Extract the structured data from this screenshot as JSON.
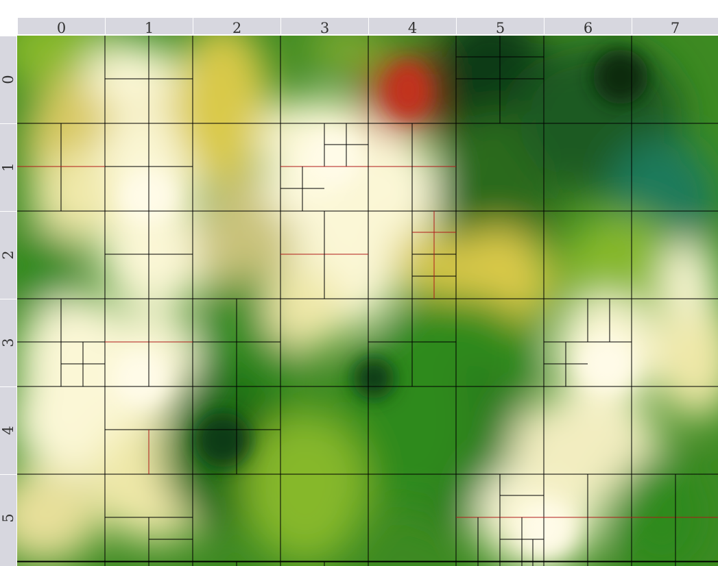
{
  "grid": {
    "columns": [
      "0",
      "1",
      "2",
      "3",
      "4",
      "5",
      "6",
      "7"
    ],
    "rows": [
      "0",
      "1",
      "2",
      "3",
      "4",
      "5"
    ]
  },
  "colors": {
    "header_bg": "#d7d7df",
    "grid_line": "#000000",
    "highlight_line": "#b01818"
  }
}
